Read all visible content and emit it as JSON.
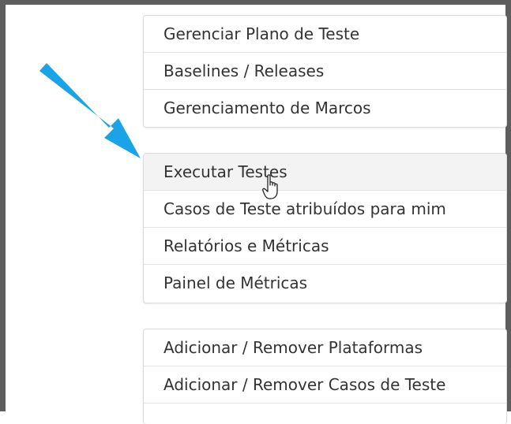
{
  "menu": {
    "group1": [
      {
        "label": "Gerenciar Plano de Teste"
      },
      {
        "label": "Baselines / Releases"
      },
      {
        "label": "Gerenciamento de Marcos"
      }
    ],
    "group2": [
      {
        "label": "Executar Testes"
      },
      {
        "label": "Casos de Teste atribuídos para mim"
      },
      {
        "label": "Relatórios e Métricas"
      },
      {
        "label": "Painel de Métricas"
      }
    ],
    "group3": [
      {
        "label": "Adicionar / Remover Plataformas"
      },
      {
        "label": "Adicionar / Remover Casos de Teste"
      },
      {
        "label": ""
      }
    ]
  },
  "annotation": {
    "arrow_color": "#1aa3e6",
    "arrow_icon": "pointer-arrow"
  },
  "cursor": {
    "icon": "hand-pointer"
  }
}
